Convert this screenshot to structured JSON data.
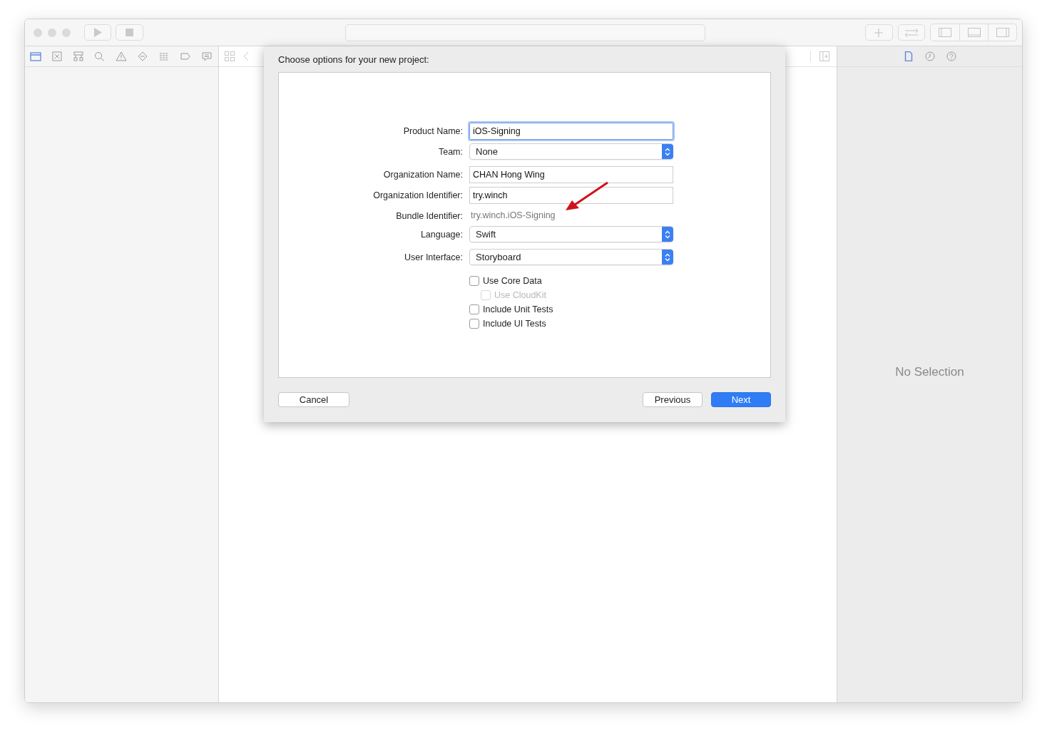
{
  "navigator_tabs": [
    {
      "kind": "folder",
      "selected": true
    },
    {
      "kind": "source-control",
      "selected": false
    },
    {
      "kind": "hierarchy",
      "selected": false
    },
    {
      "kind": "search",
      "selected": false
    },
    {
      "kind": "warning",
      "selected": false
    },
    {
      "kind": "test",
      "selected": false
    },
    {
      "kind": "debug",
      "selected": false
    },
    {
      "kind": "breakpoint",
      "selected": false
    },
    {
      "kind": "report",
      "selected": false
    }
  ],
  "inspector_tabs": [
    {
      "kind": "file",
      "selected": true
    },
    {
      "kind": "history",
      "selected": false
    },
    {
      "kind": "help",
      "selected": false
    }
  ],
  "dialog": {
    "title": "Choose options for your new project:",
    "fields": [
      {
        "kind": "text",
        "label": "Product Name:",
        "value": "iOS-Signing",
        "focused": true
      },
      {
        "kind": "popup",
        "label": "Team:",
        "value": "None"
      },
      {
        "kind": "text",
        "label": "Organization Name:",
        "value": "CHAN Hong Wing",
        "focused": false
      },
      {
        "kind": "text",
        "label": "Organization Identifier:",
        "value": "try.winch",
        "focused": false
      },
      {
        "kind": "static",
        "label": "Bundle Identifier:",
        "value": "try.winch.iOS-Signing"
      },
      {
        "kind": "popup",
        "label": "Language:",
        "value": "Swift"
      },
      {
        "kind": "popup",
        "label": "User Interface:",
        "value": "Storyboard"
      }
    ],
    "checkboxes": [
      {
        "label": "Use Core Data",
        "checked": false,
        "disabled": false,
        "children": [
          {
            "label": "Use CloudKit",
            "checked": false,
            "disabled": true
          }
        ]
      },
      {
        "label": "Include Unit Tests",
        "checked": false,
        "disabled": false
      },
      {
        "label": "Include UI Tests",
        "checked": false,
        "disabled": false
      }
    ],
    "buttons": {
      "cancel": "Cancel",
      "previous": "Previous",
      "next": "Next"
    }
  },
  "inspector": {
    "empty_text": "No Selection"
  }
}
